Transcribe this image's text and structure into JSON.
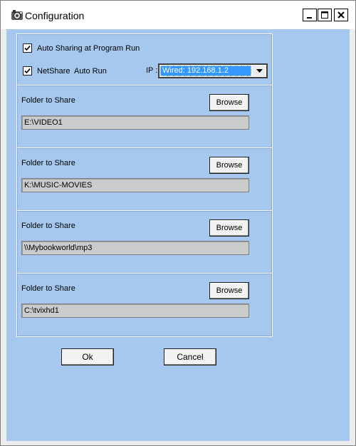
{
  "window": {
    "title": "Configuration",
    "icon": "app-icon",
    "controls": {
      "minimize": "minimize-icon",
      "maximize": "maximize-icon",
      "close": "close-icon"
    }
  },
  "options": {
    "auto_sharing": {
      "label": "Auto Sharing at Program Run",
      "checked": true
    },
    "netshare_autorun": {
      "label": "NetShare  Auto Run",
      "checked": true
    },
    "ip": {
      "label": "IP :",
      "value": "Wired: 192.168.1.2"
    }
  },
  "folders": [
    {
      "label": "Folder to Share",
      "browse": "Browse",
      "path": "E:\\VIDEO1"
    },
    {
      "label": "Folder to Share",
      "browse": "Browse",
      "path": "K:\\MUSIC-MOVIES"
    },
    {
      "label": "Folder to Share",
      "browse": "Browse",
      "path": "\\\\Mybookworld\\mp3"
    },
    {
      "label": "Folder to Share",
      "browse": "Browse",
      "path": "C:\\tvixhd1"
    }
  ],
  "buttons": {
    "ok": "Ok",
    "cancel": "Cancel"
  }
}
